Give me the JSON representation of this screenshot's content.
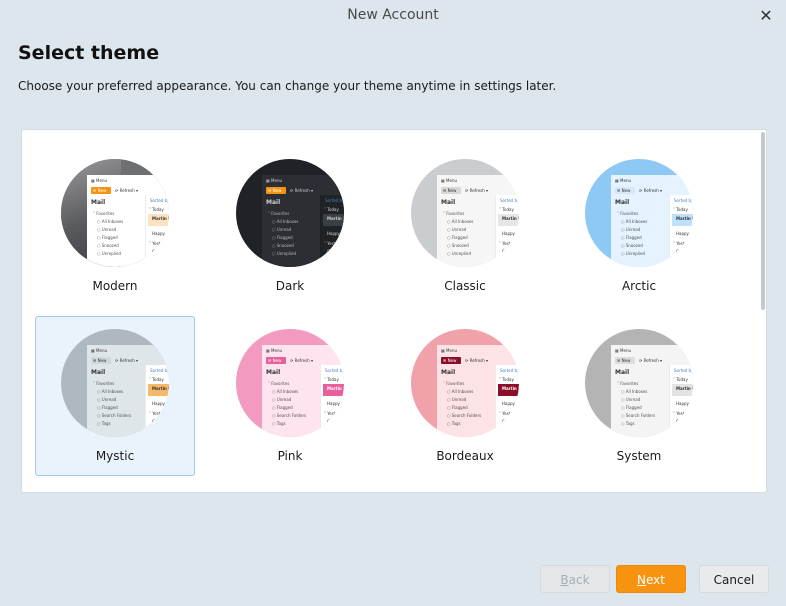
{
  "window": {
    "title": "New Account",
    "close_icon": "close-icon"
  },
  "page": {
    "heading": "Select theme",
    "description": "Choose your preferred appearance. You can change your theme anytime in settings later."
  },
  "preview": {
    "menu": "Menu",
    "new": "New",
    "refresh": "Refresh",
    "mail": "Mail",
    "sorted": "Sorted by: Recei",
    "folders": [
      "Favorites",
      "All Inboxes",
      "Unread",
      "Flagged",
      "Snoozed",
      "Unreplied"
    ],
    "alt_folders": [
      "Favorites",
      "All Inboxes",
      "Unread",
      "Flagged",
      "Search Folders",
      "Tags"
    ],
    "list_groups": [
      "Today",
      "Yesterday"
    ],
    "messages": [
      "Martin Hale",
      "Happy Co",
      "Come"
    ]
  },
  "themes": [
    {
      "label": "Modern",
      "selected": false
    },
    {
      "label": "Dark",
      "selected": false
    },
    {
      "label": "Classic",
      "selected": false
    },
    {
      "label": "Arctic",
      "selected": false
    },
    {
      "label": "Mystic",
      "selected": true
    },
    {
      "label": "Pink",
      "selected": false
    },
    {
      "label": "Bordeaux",
      "selected": false
    },
    {
      "label": "System",
      "selected": false
    }
  ],
  "buttons": {
    "back": {
      "mnemonic": "B",
      "rest": "ack"
    },
    "next": {
      "mnemonic": "N",
      "rest": "ext"
    },
    "cancel": "Cancel"
  },
  "colors": {
    "accent": "#f8930f",
    "selection": "#e9f3fc",
    "background": "#dce6ec"
  }
}
